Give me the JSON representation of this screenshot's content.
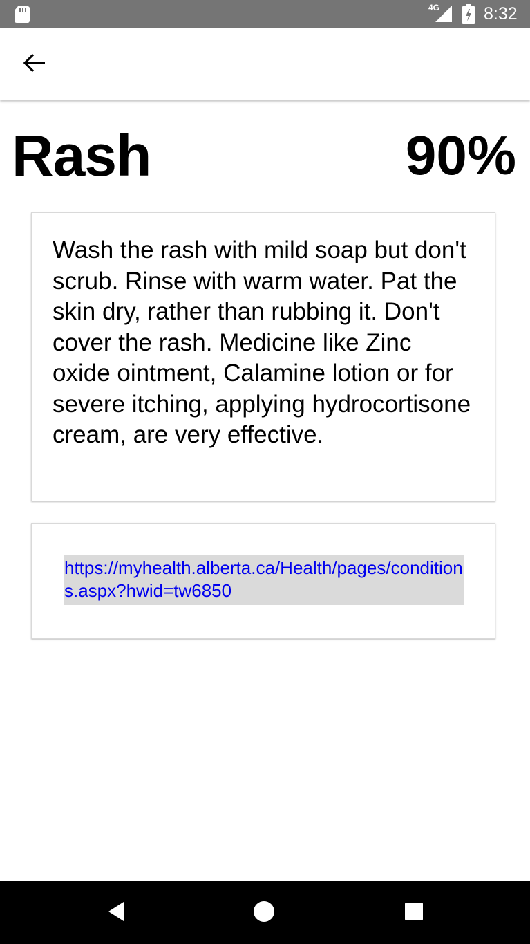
{
  "status_bar": {
    "time": "8:32",
    "network_label": "4G",
    "icons": [
      "sd-card-icon",
      "signal-icon",
      "battery-charging-icon"
    ]
  },
  "app_bar": {
    "back_icon": "arrow-left-icon"
  },
  "condition": {
    "title": "Rash",
    "confidence": "90%",
    "advice": "Wash the rash with mild soap but don't scrub. Rinse with warm water. Pat the skin dry, rather than rubbing it. Don't cover the rash. Medicine like Zinc oxide ointment, Calamine lotion or for severe itching, applying hydrocortisone cream, are very effective.",
    "link": "https://myhealth.alberta.ca/Health/pages/conditions.aspx?hwid=tw6850"
  },
  "nav_bar": {
    "icons": [
      "back-triangle-icon",
      "home-circle-icon",
      "recents-square-icon"
    ]
  },
  "colors": {
    "status_bar": "#757575",
    "link": "#0000ee",
    "link_background": "#dadada",
    "nav_bar": "#000000"
  }
}
